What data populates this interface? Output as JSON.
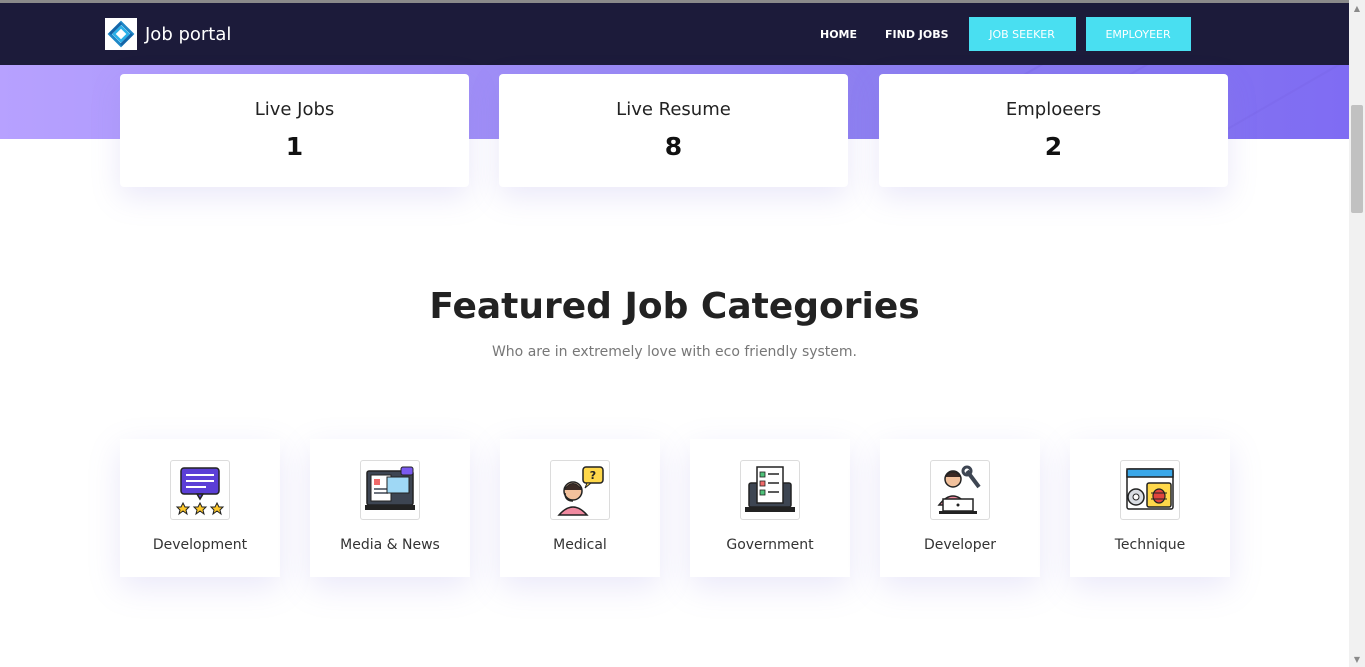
{
  "navbar": {
    "brand": "Job portal",
    "links": [
      "HOME",
      "FIND JOBS"
    ],
    "job_seeker_label": "JOB SEEKER",
    "employer_label": "EMPLOYEER",
    "colors": {
      "background": "#1c1b3a",
      "button": "#49dff1"
    }
  },
  "stats": [
    {
      "label": "Live Jobs",
      "value": "1"
    },
    {
      "label": "Live Resume",
      "value": "8"
    },
    {
      "label": "Emploeers",
      "value": "2"
    }
  ],
  "featured": {
    "title": "Featured Job Categories",
    "subtitle": "Who are in extremely love with eco friendly system."
  },
  "categories": [
    {
      "label": "Development",
      "icon": "rating-chat-icon"
    },
    {
      "label": "Media & News",
      "icon": "news-monitor-icon"
    },
    {
      "label": "Medical",
      "icon": "support-agent-icon"
    },
    {
      "label": "Government",
      "icon": "checklist-laptop-icon"
    },
    {
      "label": "Developer",
      "icon": "developer-wrench-icon"
    },
    {
      "label": "Technique",
      "icon": "bug-settings-icon"
    }
  ],
  "colors": {
    "hero_gradient_start": "#b7a1ff",
    "hero_gradient_end": "#7f6cf3"
  }
}
